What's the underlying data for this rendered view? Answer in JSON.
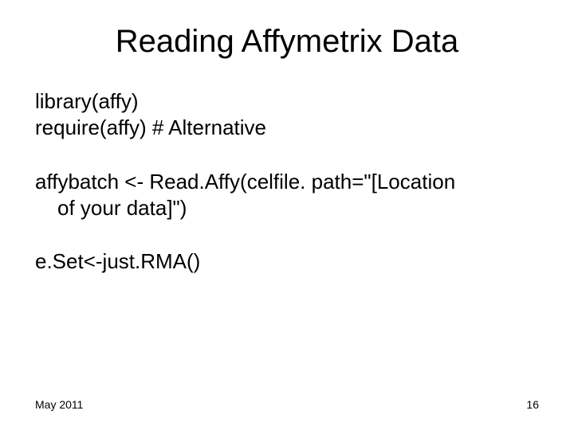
{
  "title": "Reading Affymetrix Data",
  "lines": {
    "l1": "library(affy)",
    "l2": "require(affy)   # Alternative",
    "l3": "affybatch <- Read.Affy(celfile. path=\"[Location",
    "l3b": "of your data]\")",
    "l4": "e.Set<-just.RMA()"
  },
  "footer": {
    "date": "May 2011",
    "page": "16"
  }
}
